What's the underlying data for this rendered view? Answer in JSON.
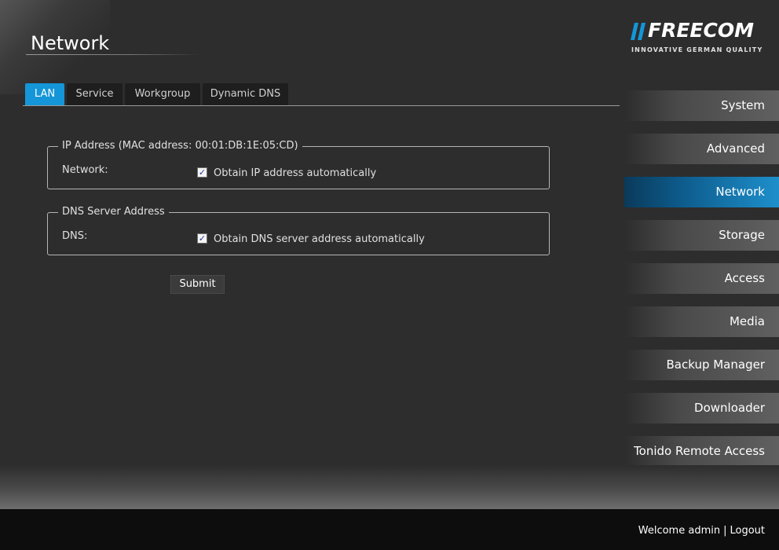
{
  "page": {
    "title": "Network"
  },
  "logo": {
    "wordmark": "FREECOM",
    "tagline": "INNOVATIVE GERMAN QUALITY"
  },
  "tabs": [
    {
      "label": "LAN",
      "active": true
    },
    {
      "label": "Service",
      "active": false
    },
    {
      "label": "Workgroup",
      "active": false
    },
    {
      "label": "Dynamic DNS",
      "active": false
    }
  ],
  "ip_section": {
    "legend": "IP Address (MAC address: 00:01:DB:1E:05:CD)",
    "field_label": "Network:",
    "checkbox_label": "Obtain IP address automatically",
    "checked": true
  },
  "dns_section": {
    "legend": "DNS Server Address",
    "field_label": "DNS:",
    "checkbox_label": "Obtain DNS server address automatically",
    "checked": true
  },
  "submit": {
    "label": "Submit"
  },
  "nav": {
    "items": [
      {
        "label": "System",
        "active": false
      },
      {
        "label": "Advanced",
        "active": false
      },
      {
        "label": "Network",
        "active": true
      },
      {
        "label": "Storage",
        "active": false
      },
      {
        "label": "Access",
        "active": false
      },
      {
        "label": "Media",
        "active": false
      },
      {
        "label": "Backup Manager",
        "active": false
      },
      {
        "label": "Downloader",
        "active": false
      },
      {
        "label": "Tonido Remote Access",
        "active": false
      }
    ]
  },
  "footer": {
    "welcome": "Welcome admin",
    "separator": "|",
    "logout": "Logout"
  },
  "colors": {
    "accent": "#1496d8",
    "background": "#2d2d2d",
    "footer": "#0d0d0d"
  },
  "icons": {
    "checkbox_checked": "checkmark-icon"
  }
}
